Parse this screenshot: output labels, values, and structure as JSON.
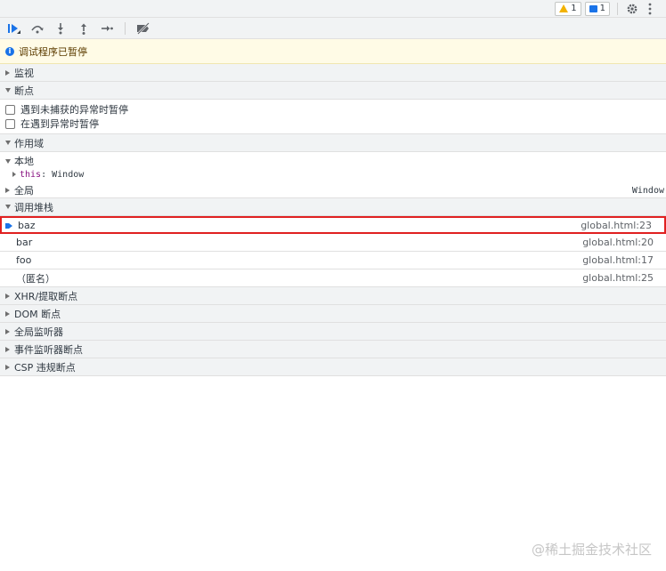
{
  "topbar": {
    "warning_count": "1",
    "message_count": "1",
    "icons": [
      "warning-icon",
      "message-icon",
      "gear-icon",
      "more-icon"
    ]
  },
  "debugger_toolbar": {
    "icons": [
      "resume-icon",
      "step-over-icon",
      "step-into-icon",
      "step-out-icon",
      "step-icon",
      "deactivate-breakpoints-icon"
    ]
  },
  "paused_banner": {
    "text": "调试程序已暂停"
  },
  "sections": {
    "watch": "监视",
    "breakpoints": "断点",
    "scope": "作用域",
    "call_stack": "调用堆栈",
    "xhr": "XHR/提取断点",
    "dom": "DOM 断点",
    "global_listeners": "全局监听器",
    "event_listeners": "事件监听器断点",
    "csp": "CSP 违规断点"
  },
  "breakpoints": {
    "pause_uncaught": "遇到未捕获的异常时暂停",
    "pause_caught": "在遇到异常时暂停"
  },
  "scope": {
    "local_label": "本地",
    "this_key": "this",
    "this_value": "Window",
    "global_label": "全局",
    "global_value": "Window"
  },
  "call_stack": [
    {
      "name": "baz",
      "location": "global.html:23"
    },
    {
      "name": "bar",
      "location": "global.html:20"
    },
    {
      "name": "foo",
      "location": "global.html:17"
    },
    {
      "name": "（匿名）",
      "location": "global.html:25"
    }
  ],
  "watermark": "@稀土掘金技术社区",
  "colors": {
    "accent": "#1a73e8",
    "highlight_border": "#e02020",
    "paused_bg": "#fffbe6",
    "warning": "#f2b200"
  }
}
